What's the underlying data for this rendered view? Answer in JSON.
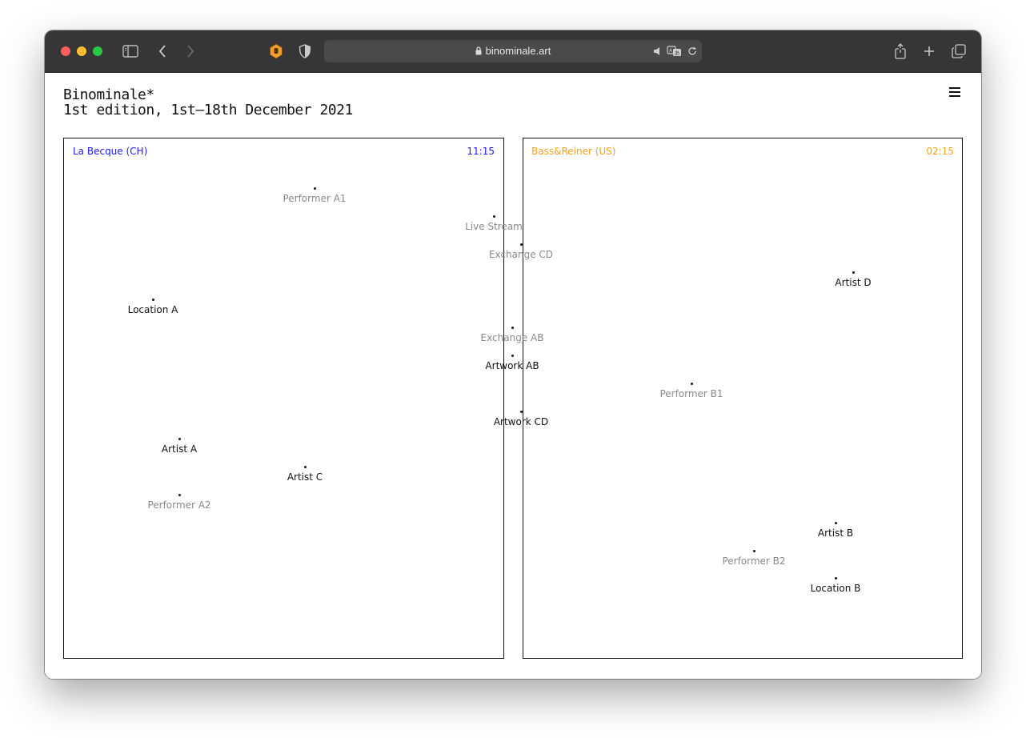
{
  "browser": {
    "url": "binominale.art",
    "extension_icons": [
      "hand-shield-icon",
      "shield-half-icon"
    ],
    "address_icons": [
      "lock-icon",
      "speaker-icon",
      "translate-icon",
      "reload-icon"
    ]
  },
  "site": {
    "title_line1": "Binominale*",
    "title_line2": "1st edition, 1st–18th December 2021"
  },
  "left_panel": {
    "location": "La Becque (CH)",
    "time": "11:15",
    "color": "#1a1aff"
  },
  "right_panel": {
    "location": "Bass&Reiner (US)",
    "time": "02:15",
    "color": "#f7a21b"
  },
  "nodes": [
    {
      "label": "Performer A1",
      "tone": "grey"
    },
    {
      "label": "Live Stream",
      "tone": "grey"
    },
    {
      "label": "Exchange CD",
      "tone": "grey"
    },
    {
      "label": "Artist D",
      "tone": "dark"
    },
    {
      "label": "Location A",
      "tone": "dark"
    },
    {
      "label": "Exchange AB",
      "tone": "grey"
    },
    {
      "label": "Artwork AB",
      "tone": "dark"
    },
    {
      "label": "Performer B1",
      "tone": "grey"
    },
    {
      "label": "Artwork CD",
      "tone": "dark"
    },
    {
      "label": "Artist A",
      "tone": "dark"
    },
    {
      "label": "Artist C",
      "tone": "dark"
    },
    {
      "label": "Performer A2",
      "tone": "grey"
    },
    {
      "label": "Artist B",
      "tone": "dark"
    },
    {
      "label": "Performer B2",
      "tone": "grey"
    },
    {
      "label": "Location B",
      "tone": "dark"
    }
  ]
}
